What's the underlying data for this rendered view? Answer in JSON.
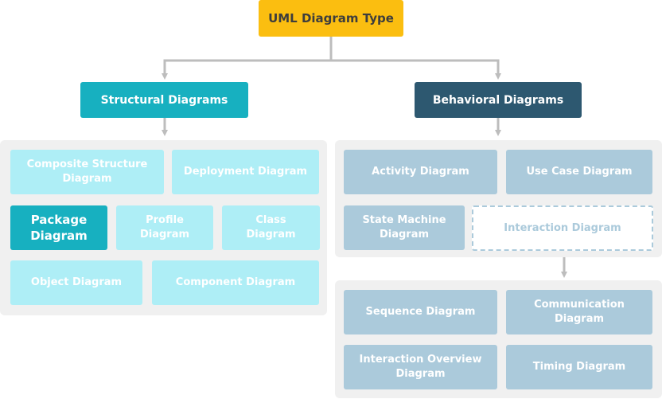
{
  "diagram": {
    "root": {
      "label": "UML Diagram Type"
    },
    "structural": {
      "label": "Structural Diagrams",
      "items": [
        {
          "label": "Composite Structure Diagram",
          "highlighted": false
        },
        {
          "label": "Deployment Diagram",
          "highlighted": false
        },
        {
          "label": "Package Diagram",
          "highlighted": true
        },
        {
          "label": "Profile Diagram",
          "highlighted": false
        },
        {
          "label": "Class Diagram",
          "highlighted": false
        },
        {
          "label": "Object Diagram",
          "highlighted": false
        },
        {
          "label": "Component Diagram",
          "highlighted": false
        }
      ]
    },
    "behavioral": {
      "label": "Behavioral Diagrams",
      "items": [
        {
          "label": "Activity Diagram"
        },
        {
          "label": "Use Case Diagram"
        },
        {
          "label": "State Machine Diagram"
        },
        {
          "label": "Interaction Diagram",
          "abstract": true
        }
      ],
      "interaction": {
        "items": [
          {
            "label": "Sequence Diagram"
          },
          {
            "label": "Communication Diagram"
          },
          {
            "label": "Interaction Overview Diagram"
          },
          {
            "label": "Timing Diagram"
          }
        ]
      }
    },
    "colors": {
      "root": "#FBBE10",
      "structural": "#17B0C0",
      "behavioral": "#2D5870",
      "structural_leaf": "#AEEEF6",
      "behavioral_leaf": "#ABCADB",
      "group_bg": "#F0F0F0",
      "connector": "#BDBDBD"
    }
  }
}
